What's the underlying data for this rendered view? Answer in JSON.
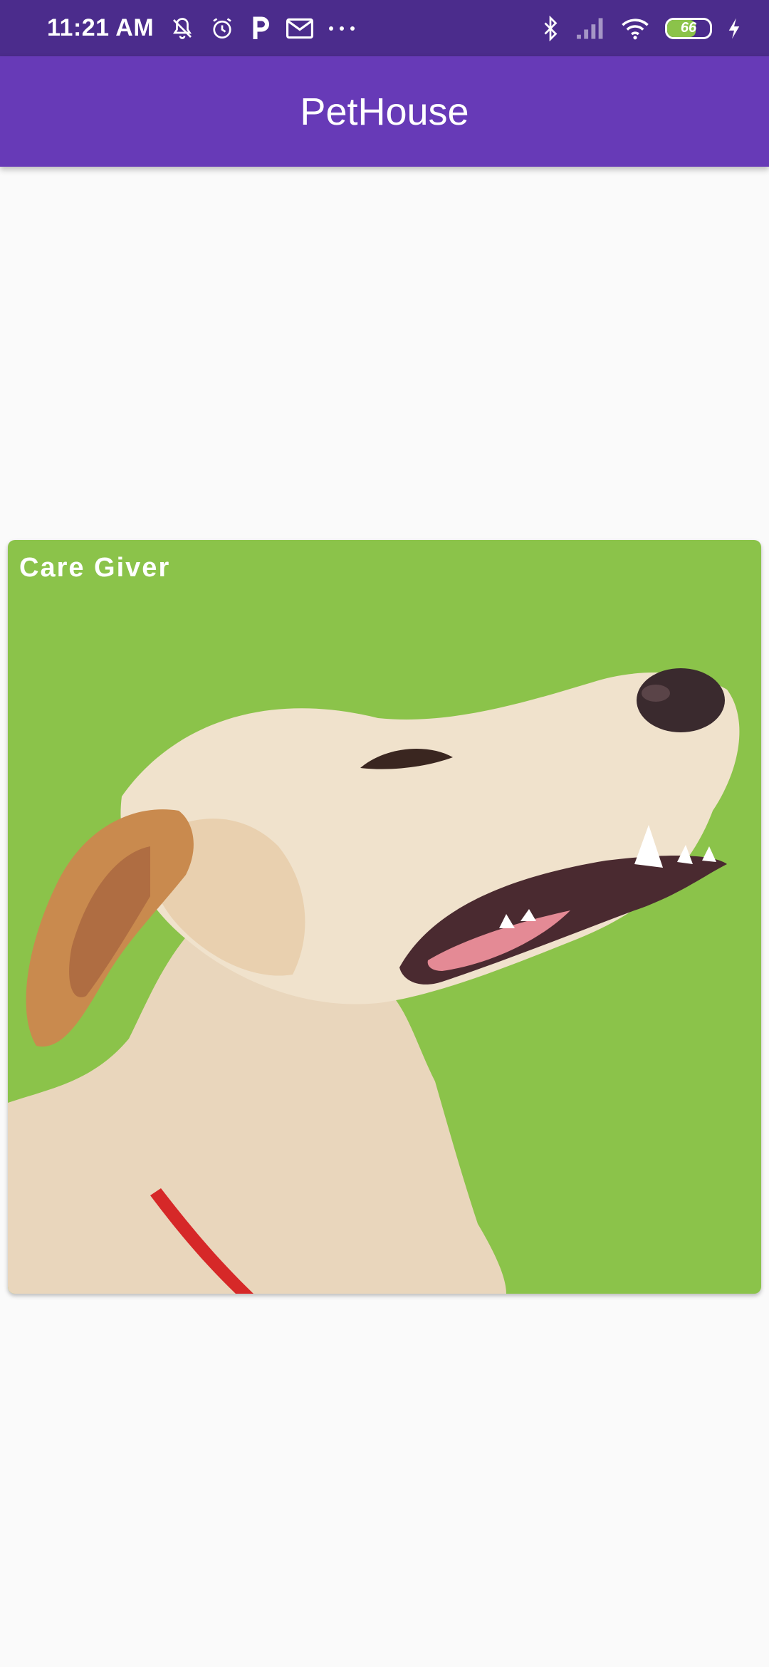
{
  "status_bar": {
    "time": "11:21 AM",
    "battery_level": "66",
    "battery_fraction": 0.66,
    "icons": [
      "mute-icon",
      "alarm-icon",
      "parking-icon",
      "gmail-icon",
      "more-dots-icon",
      "bluetooth-icon",
      "signal-icon",
      "wifi-icon",
      "battery-icon",
      "charging-icon"
    ]
  },
  "app_bar": {
    "title": "PetHouse"
  },
  "card": {
    "label": "Care Giver",
    "image": "dog-photo"
  },
  "colors": {
    "status_bar": "#4b2c8c",
    "app_bar": "#673ab7",
    "card_background": "#8bc34a",
    "page_background": "#fafafa"
  }
}
